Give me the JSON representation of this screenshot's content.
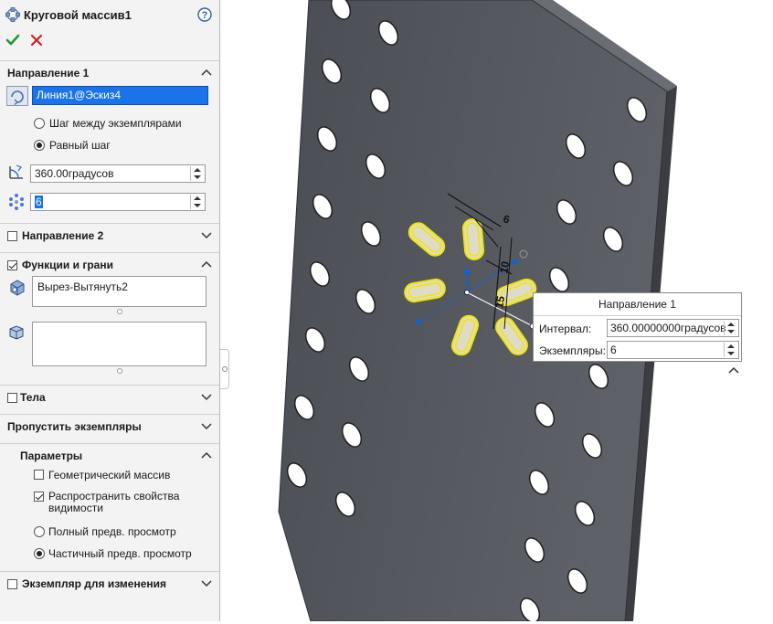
{
  "property_manager": {
    "title": "Круговой массив1",
    "direction1": {
      "label": "Направление 1",
      "axis_value": "Линия1@Эскиз4",
      "option_step": "Шаг между экземплярами",
      "option_equal": "Равный шаг",
      "angle_value": "360.00градусов",
      "count_value": "6"
    },
    "direction2": {
      "label": "Направление 2"
    },
    "features": {
      "label": "Функции и грани",
      "feature_item": "Вырез-Вытянуть2"
    },
    "bodies": {
      "label": "Тела"
    },
    "skip": {
      "label": "Пропустить экземпляры"
    },
    "params": {
      "label": "Параметры",
      "geometric": "Геометрический массив",
      "propagate": "Распространить свойства видимости",
      "full_preview": "Полный предв. просмотр",
      "partial_preview": "Частичный предв. просмотр"
    },
    "vary": {
      "label": "Экземпляр для изменения"
    }
  },
  "callout": {
    "title": "Направление 1",
    "interval_label": "Интервал:",
    "interval_value": "360.00000000градусов",
    "instances_label": "Экземпляры:",
    "instances_value": "6"
  },
  "dimensions": {
    "d1": "6",
    "d2": "10",
    "d3": "15"
  },
  "colors": {
    "plate": "#54575e",
    "plate_edge": "#3b3d42",
    "preview": "#f2e600",
    "selection": "#0a64d6"
  }
}
